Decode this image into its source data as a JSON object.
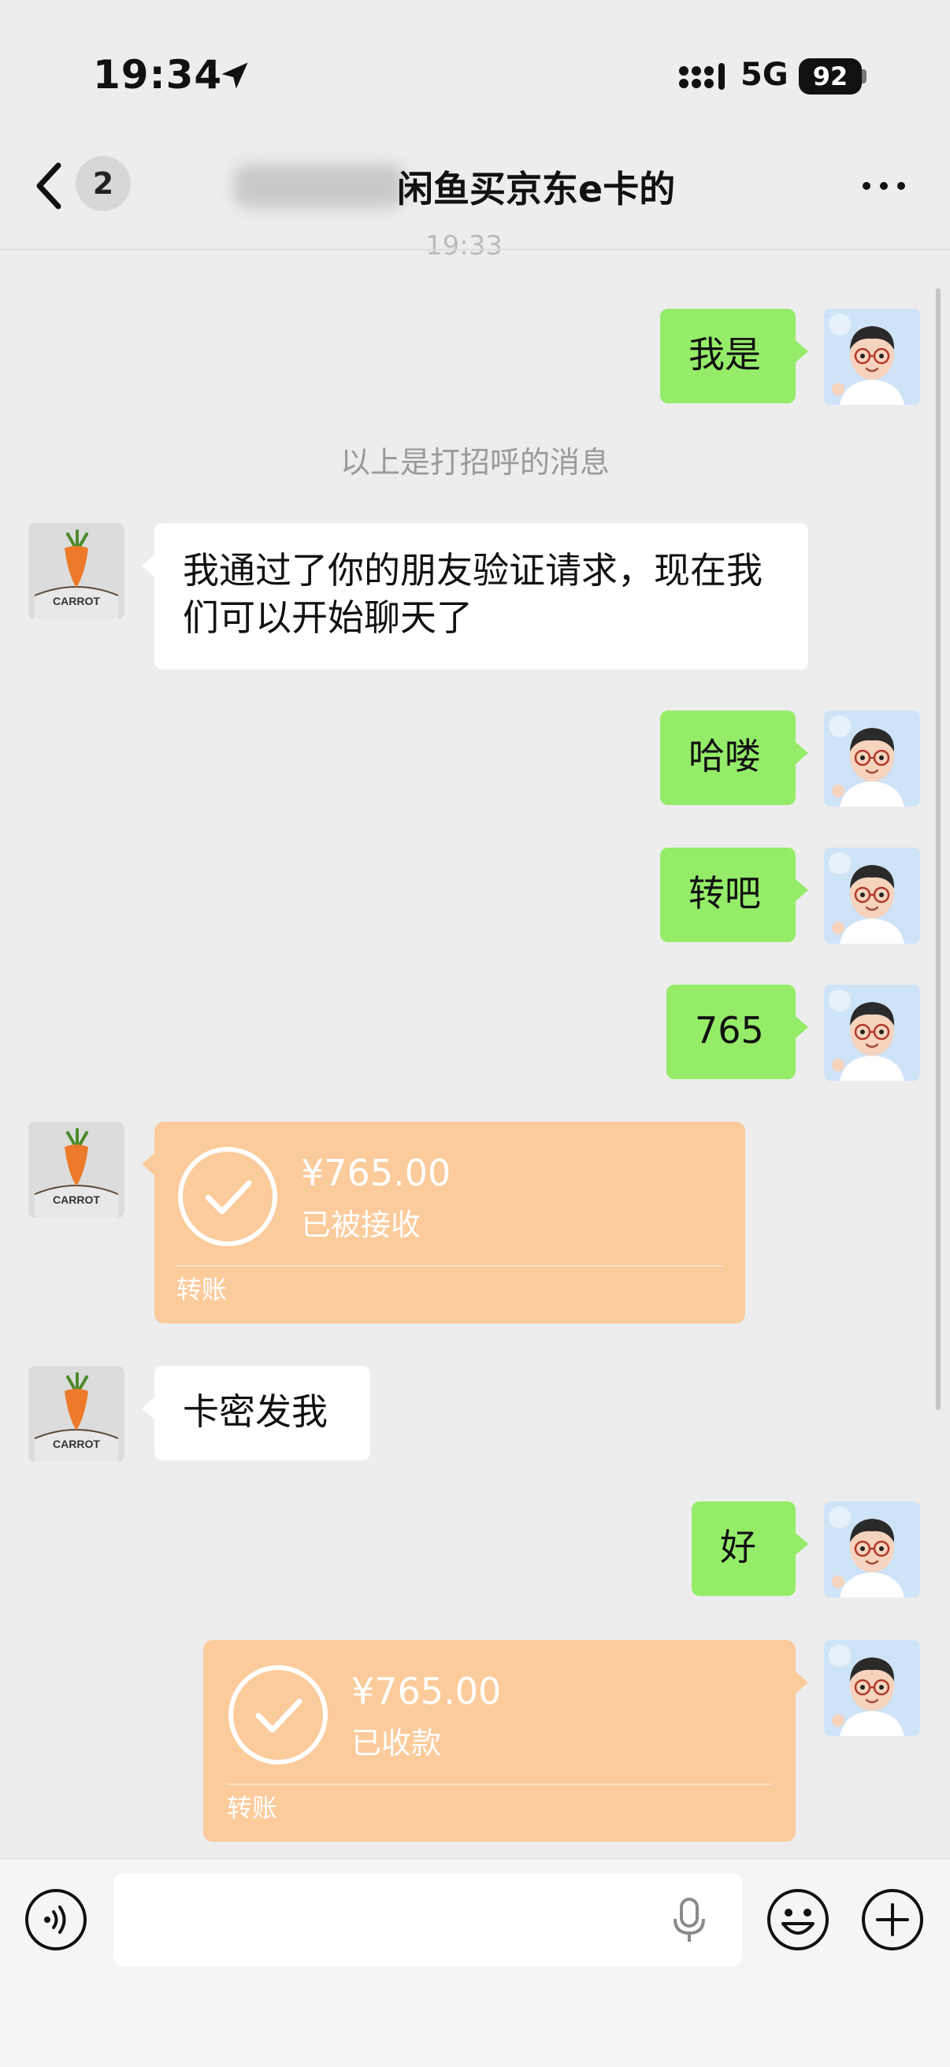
{
  "status_bar": {
    "time": "19:34",
    "network": "5G",
    "battery": "92"
  },
  "nav": {
    "unread_count": "2",
    "title": "闲鱼买京东e卡的",
    "peek_time": "19:33"
  },
  "messages": {
    "m1": "我是",
    "system": "以上是打招呼的消息",
    "m2": "我通过了你的朋友验证请求，现在我们可以开始聊天了",
    "m3": "哈喽",
    "m4": "转吧",
    "m5": "765",
    "t1": {
      "amount": "¥765.00",
      "status": "已被接收",
      "label": "转账"
    },
    "m6": "卡密发我",
    "m7": "好",
    "t2": {
      "amount": "¥765.00",
      "status": "已收款",
      "label": "转账"
    }
  },
  "avatars": {
    "contact": "CARROT"
  },
  "colors": {
    "sent_bubble": "#95ec69",
    "received_bubble": "#ffffff",
    "transfer": "#fbcb9b",
    "background": "#ededed"
  },
  "icons": [
    "location-arrow-icon",
    "signal-icon",
    "back-chevron-icon",
    "more-icon",
    "voice-icon",
    "microphone-icon",
    "emoji-icon",
    "plus-icon",
    "check-circle-icon"
  ]
}
